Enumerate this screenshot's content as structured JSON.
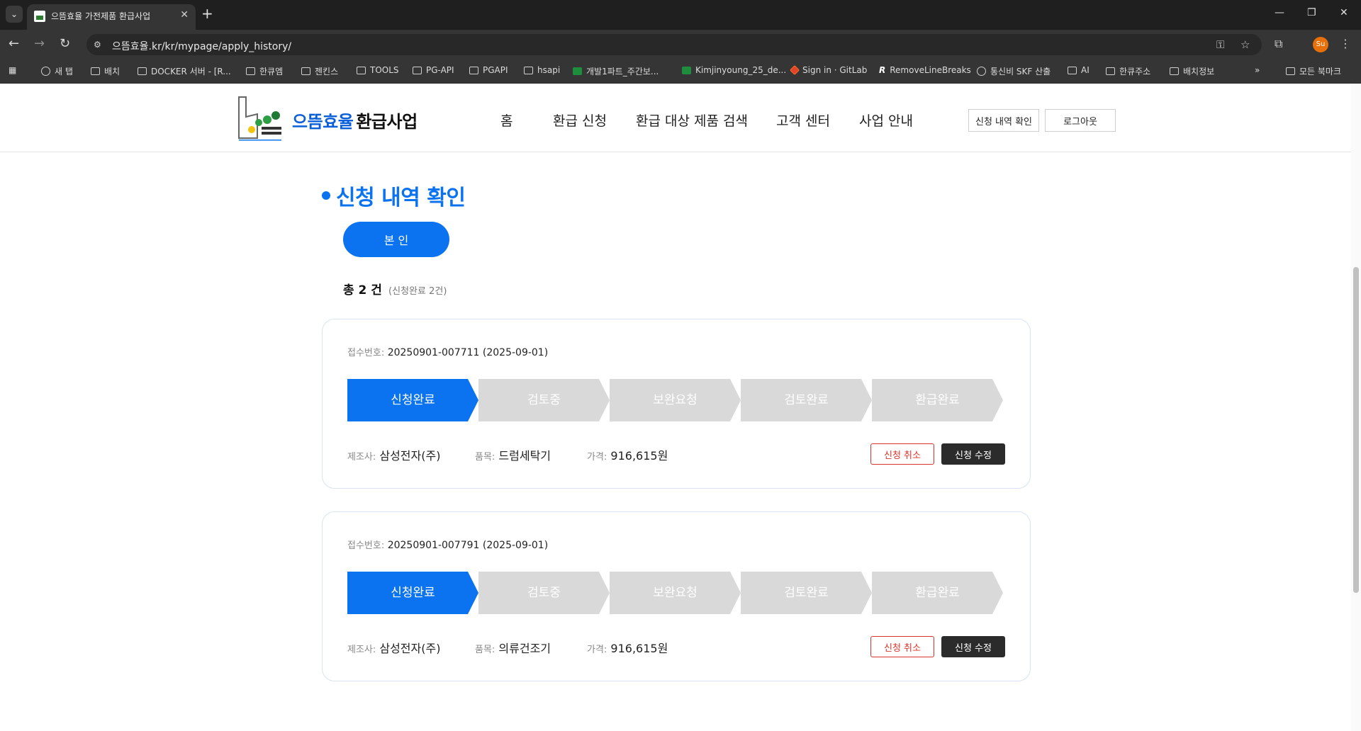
{
  "browser": {
    "tab_title": "으뜸효율 가전제품 환급사업",
    "url": "으뜸효율.kr/kr/mypage/apply_history/",
    "profile_initials": "Su",
    "bookmarks": [
      "새 탭",
      "배치",
      "DOCKER 서버 - [R...",
      "한큐엠",
      "젠킨스",
      "TOOLS",
      "PG-API",
      "PGAPI",
      "hsapi",
      "개발1파트_주간보...",
      "Kimjinyoung_25_de...",
      "Sign in · GitLab",
      "RemoveLineBreaks",
      "통신비 SKF 산출",
      "AI",
      "한큐주소",
      "배치정보"
    ],
    "bookmarks_all": "모든 북마크"
  },
  "site": {
    "brand_part1": "으뜸효율",
    "brand_part2": "환급사업",
    "nav": [
      "홈",
      "환급 신청",
      "환급 대상 제품 검색",
      "고객 센터",
      "사업 안내"
    ],
    "btn_history": "신청 내역 확인",
    "btn_logout": "로그아웃"
  },
  "main": {
    "title": "신청 내역 확인",
    "self_button": "본 인",
    "total": "총 2 건",
    "total_sub": "(신청완료 2건)",
    "labels": {
      "receipt": "접수번호:",
      "maker": "제조사:",
      "item": "품목:",
      "price": "가격:"
    },
    "steps": [
      "신청완료",
      "검토중",
      "보완요청",
      "검토완료",
      "환급완료"
    ],
    "cancel_label": "신청 취소",
    "edit_label": "신청 수정",
    "applications": [
      {
        "receipt": "20250901-007711 (2025-09-01)",
        "maker": "삼성전자(주)",
        "item": "드럼세탁기",
        "price": "916,615원",
        "active_step": 0
      },
      {
        "receipt": "20250901-007791 (2025-09-01)",
        "maker": "삼성전자(주)",
        "item": "의류건조기",
        "price": "916,615원",
        "active_step": 0
      }
    ]
  },
  "colors": {
    "accent": "#0b73f0",
    "step_inactive": "#d9d9d9",
    "cancel": "#d9342b",
    "edit": "#2b2b2b"
  }
}
